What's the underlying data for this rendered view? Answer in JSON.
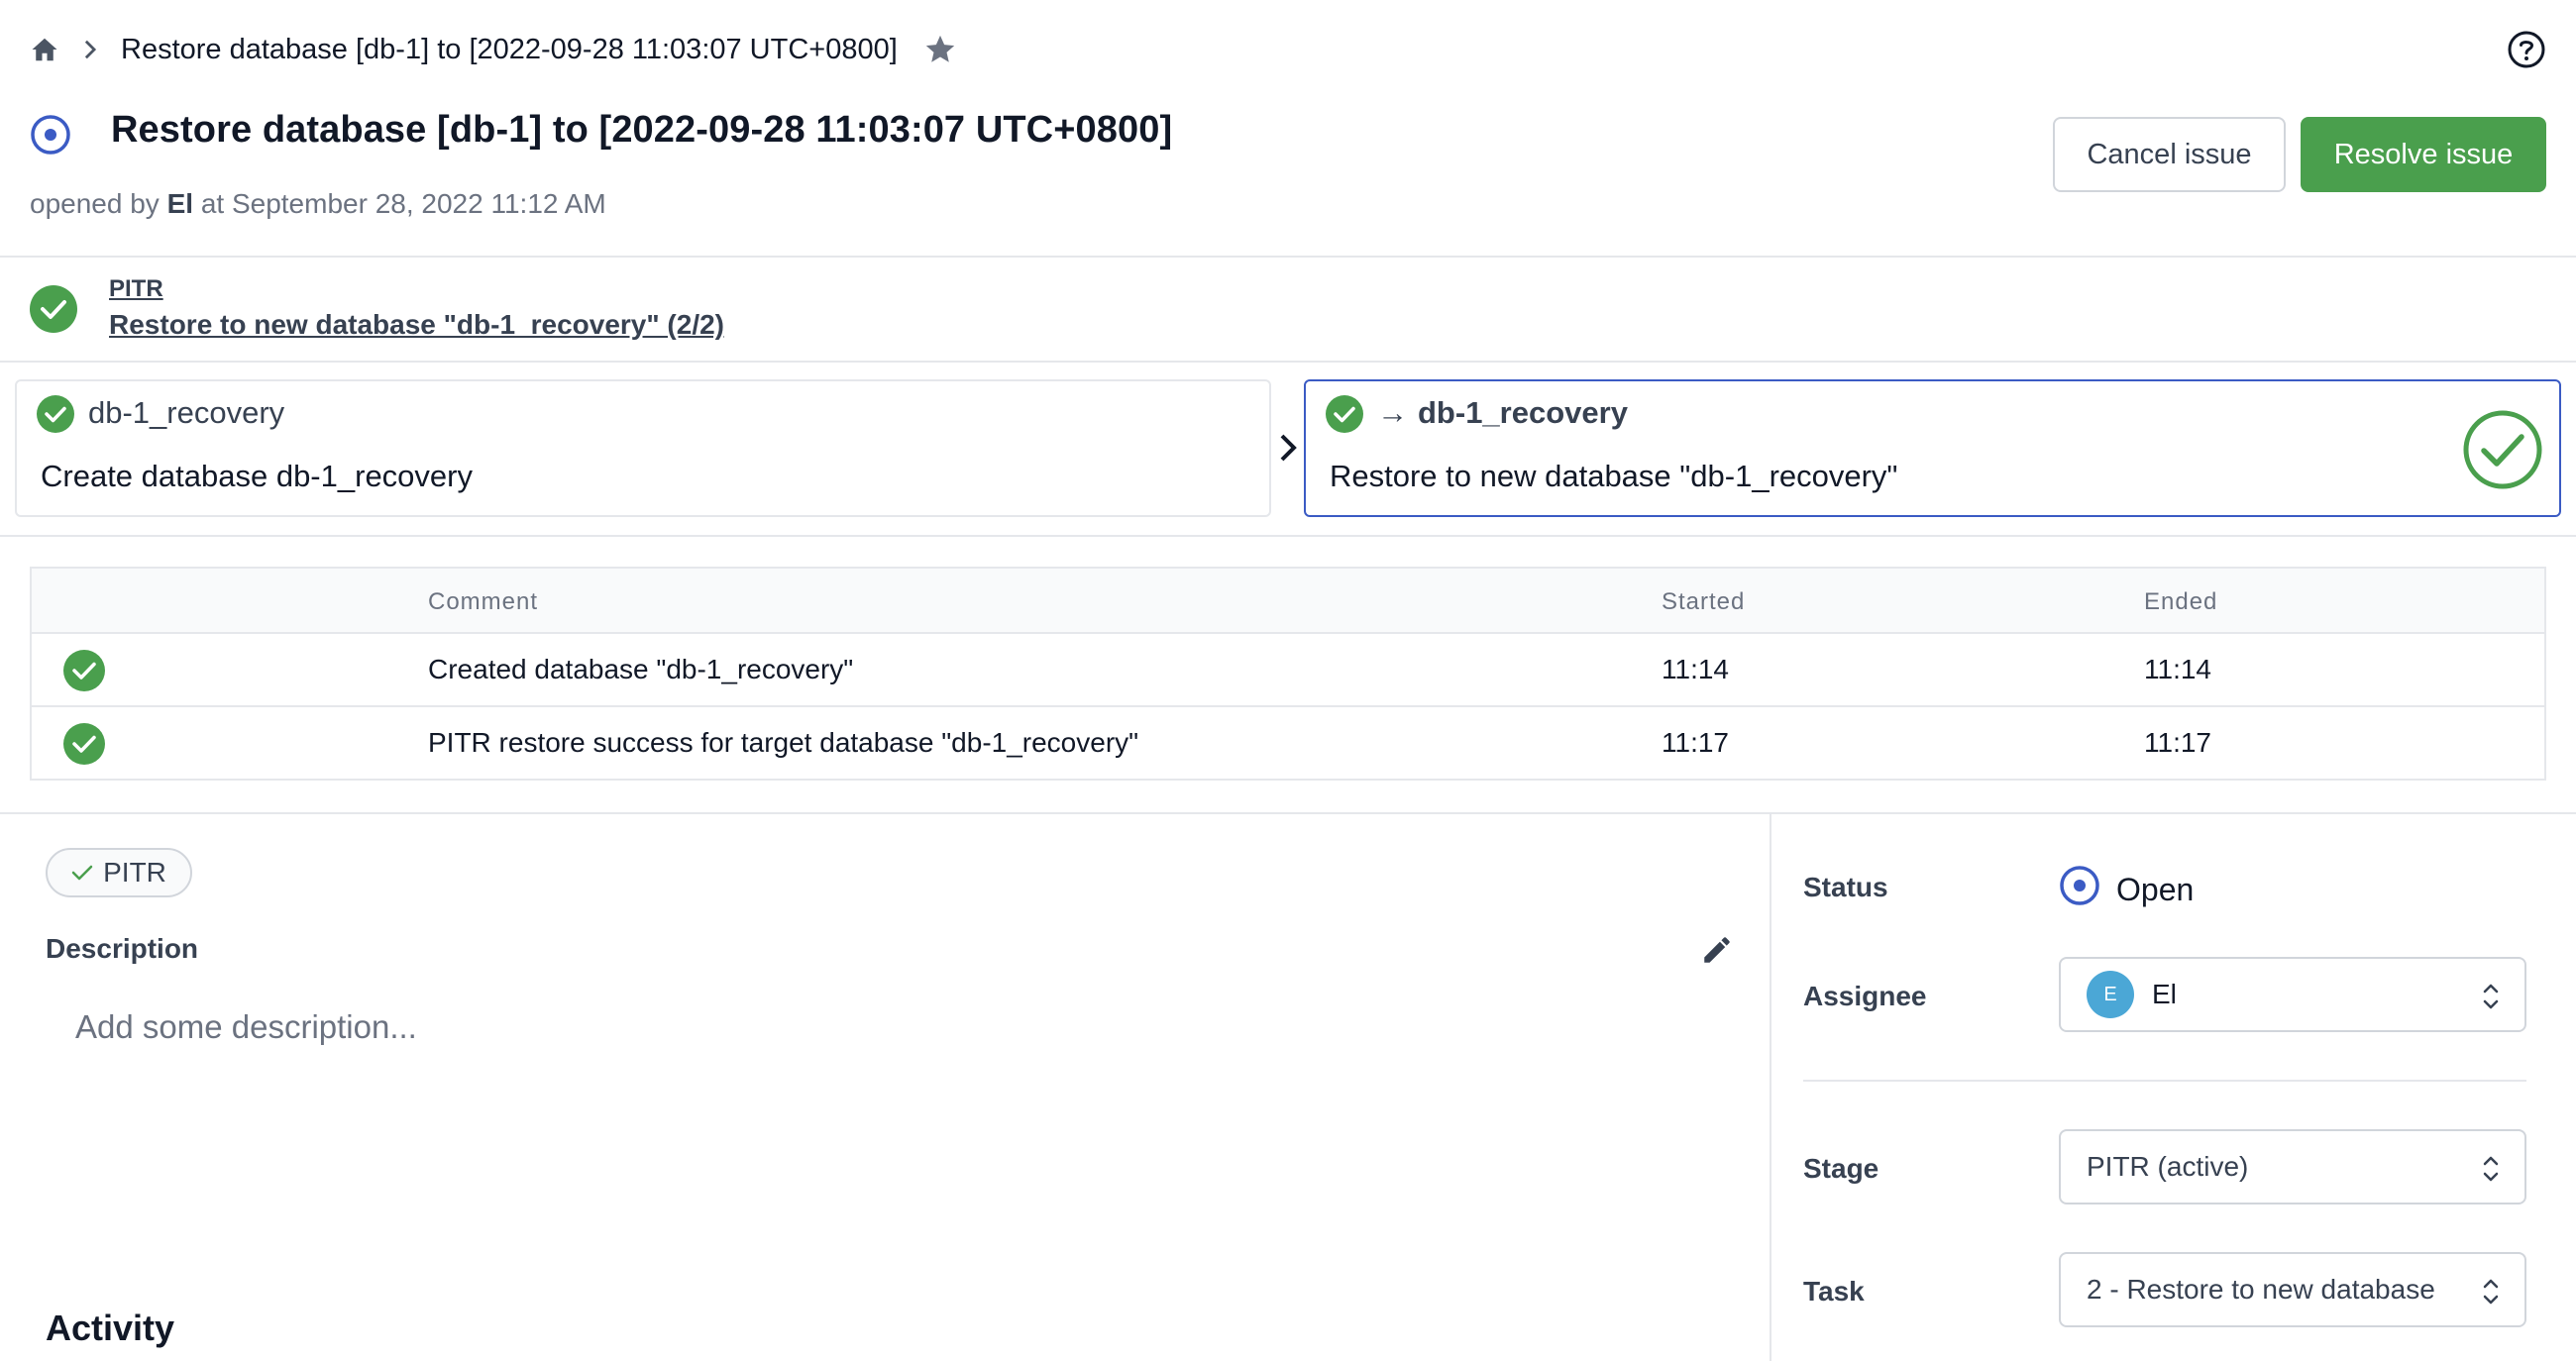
{
  "breadcrumb": {
    "icons": [
      "home-icon",
      "chevron-right-icon",
      "star-icon"
    ],
    "title": "Restore database [db-1] to [2022-09-28 11:03:07 UTC+0800]"
  },
  "header": {
    "title": "Restore database [db-1] to [2022-09-28 11:03:07 UTC+0800]",
    "opened_prefix": "opened by",
    "opened_by": "El",
    "opened_at": "at September 28, 2022 11:12 AM",
    "cancel_label": "Cancel issue",
    "resolve_label": "Resolve issue"
  },
  "stage": {
    "name": "PITR",
    "task_link": "Restore to new database \"db-1_recovery\" (2/2)"
  },
  "tasks": [
    {
      "database": "db-1_recovery",
      "description": "Create database db-1_recovery",
      "arrow": false,
      "selected": false
    },
    {
      "database": "db-1_recovery",
      "arrow_symbol": "→",
      "description": "Restore to new database \"db-1_recovery\"",
      "arrow": true,
      "selected": true
    }
  ],
  "runs_table": {
    "columns": [
      "Comment",
      "Started",
      "Ended"
    ],
    "rows": [
      {
        "status": "done",
        "comment": "Created database \"db-1_recovery\"",
        "started": "11:14",
        "ended": "11:14"
      },
      {
        "status": "done",
        "comment": "PITR restore success for target database \"db-1_recovery\"",
        "started": "11:17",
        "ended": "11:17"
      }
    ]
  },
  "details": {
    "stage_chip": "PITR",
    "description_label": "Description",
    "description_placeholder": "Add some description...",
    "activity_title": "Activity"
  },
  "sidebar": {
    "status_label": "Status",
    "status_value": "Open",
    "assignee_label": "Assignee",
    "assignee_initial": "E",
    "assignee_name": "El",
    "stage_label": "Stage",
    "stage_value": "PITR (active)",
    "task_label": "Task",
    "task_value": "2 - Restore to new database"
  },
  "colors": {
    "success": "#4a9f4d",
    "primary": "#3b5bc4",
    "avatar": "#4ba7d6"
  }
}
